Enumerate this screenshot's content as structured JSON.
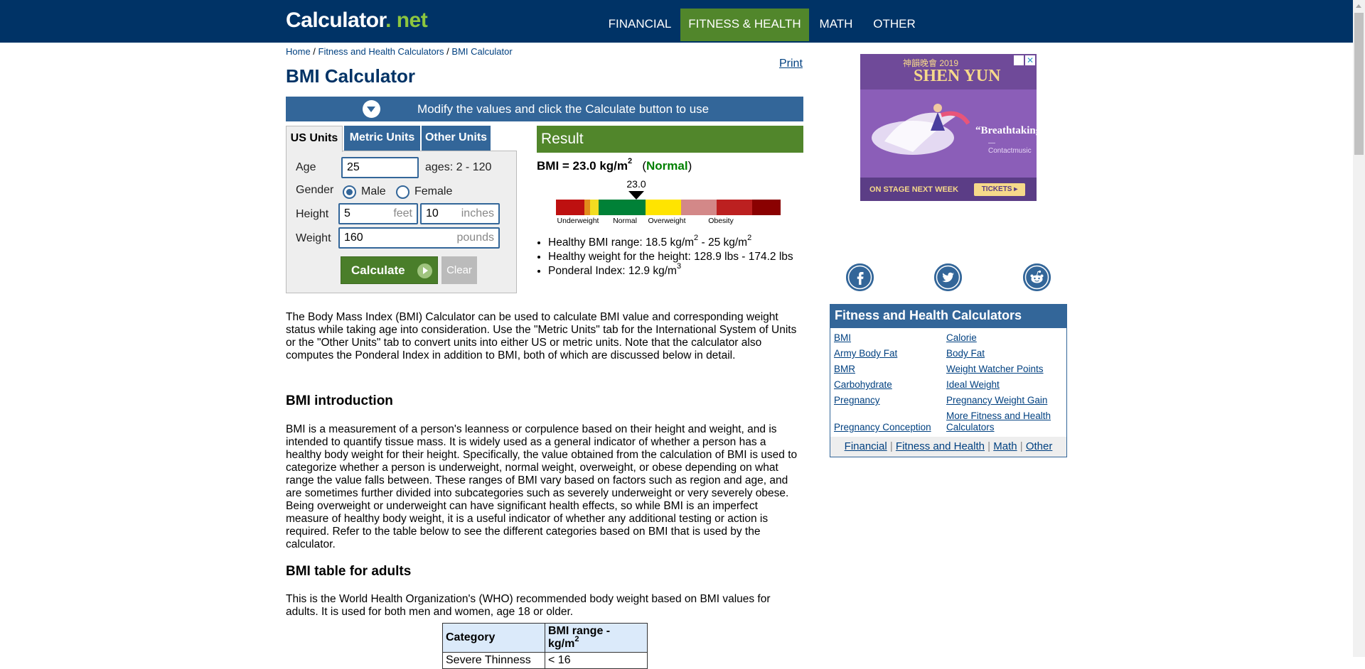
{
  "header": {
    "logo_main": "Calculator",
    "logo_dot_net": ". net",
    "nav": [
      {
        "label": "FINANCIAL",
        "active": false
      },
      {
        "label": "FITNESS & HEALTH",
        "active": true
      },
      {
        "label": "MATH",
        "active": false
      },
      {
        "label": "OTHER",
        "active": false
      }
    ]
  },
  "breadcrumb": {
    "home": "Home",
    "sep": " / ",
    "section": "Fitness and Health Calculators",
    "current": "BMI Calculator"
  },
  "print_link": "Print",
  "page_title": "BMI Calculator",
  "banner": {
    "text": "Modify the values and click the Calculate button to use"
  },
  "tabs": [
    {
      "label": "US Units",
      "active": true
    },
    {
      "label": "Metric Units",
      "active": false
    },
    {
      "label": "Other Units",
      "active": false
    }
  ],
  "form": {
    "age": {
      "label": "Age",
      "value": "25",
      "hint": "ages: 2 - 120"
    },
    "gender": {
      "label": "Gender",
      "options": [
        "Male",
        "Female"
      ],
      "selected": "Male"
    },
    "height": {
      "label": "Height",
      "feet": "5",
      "feet_unit": "feet",
      "inches": "10",
      "inches_unit": "inches"
    },
    "weight": {
      "label": "Weight",
      "value": "160",
      "unit": "pounds"
    },
    "calculate_label": "Calculate",
    "clear_label": "Clear"
  },
  "result": {
    "header": "Result",
    "bmi_prefix": "BMI = 23.0 kg/m",
    "bmi_exp": "2",
    "bmi_open": "(",
    "bmi_class": "Normal",
    "bmi_close": ")",
    "gauge": {
      "value": 23.0,
      "value_label": "23.0",
      "labels": [
        "Underweight",
        "Normal",
        "Overweight",
        "Obesity"
      ]
    },
    "items": [
      {
        "text": "Healthy BMI range: 18.5 kg/m",
        "exp1": "2",
        "text2": " - 25 kg/m",
        "exp2": "2"
      },
      {
        "text": "Healthy weight for the height: 128.9 lbs - 174.2 lbs"
      },
      {
        "text": "Ponderal Index: 12.9 kg/m",
        "exp1": "3"
      }
    ]
  },
  "article": {
    "intro": "The Body Mass Index (BMI) Calculator can be used to calculate BMI value and corresponding weight status while taking age into consideration. Use the \"Metric Units\" tab for the International System of Units or the \"Other Units\" tab to convert units into either US or metric units. Note that the calculator also computes the Ponderal Index in addition to BMI, both of which are discussed below in detail.",
    "h_intro": "BMI introduction",
    "p_intro": "BMI is a measurement of a person's leanness or corpulence based on their height and weight, and is intended to quantify tissue mass. It is widely used as a general indicator of whether a person has a healthy body weight for their height. Specifically, the value obtained from the calculation of BMI is used to categorize whether a person is underweight, normal weight, overweight, or obese depending on what range the value falls between. These ranges of BMI vary based on factors such as region and age, and are sometimes further divided into subcategories such as severely underweight or very severely obese. Being overweight or underweight can have significant health effects, so while BMI is an imperfect measure of healthy body weight, it is a useful indicator of whether any additional testing or action is required. Refer to the table below to see the different categories based on BMI that is used by the calculator.",
    "h_table": "BMI table for adults",
    "p_table": "This is the World Health Organization's (WHO) recommended body weight based on BMI values for adults. It is used for both men and women, age 18 or older.",
    "table": {
      "col1": "Category",
      "col2": "BMI range - kg/m",
      "col2_exp": "2",
      "rows": [
        {
          "category": "Severe Thinness",
          "range": "< 16"
        }
      ]
    }
  },
  "ad": {
    "chinese": "神韻晚會 2019",
    "brand": "SHEN YUN",
    "quote": "“Breathtaking”",
    "quote_source": "—Contactmusic",
    "stage_text": "ON STAGE NEXT WEEK",
    "tickets": "TICKETS ▸",
    "close": "✕"
  },
  "social": [
    {
      "name": "facebook-icon"
    },
    {
      "name": "twitter-icon"
    },
    {
      "name": "reddit-icon"
    }
  ],
  "related": {
    "title": "Fitness and Health Calculators",
    "links": [
      "BMI",
      "Calorie",
      "Army Body Fat",
      "Body Fat",
      "BMR",
      "Weight Watcher Points",
      "Carbohydrate",
      "Ideal Weight",
      "Pregnancy",
      "Pregnancy Weight Gain",
      "Pregnancy Conception",
      "More Fitness and Health Calculators"
    ],
    "footer": [
      "Financial",
      "Fitness and Health",
      "Math",
      "Other"
    ],
    "footer_sep": " | "
  }
}
